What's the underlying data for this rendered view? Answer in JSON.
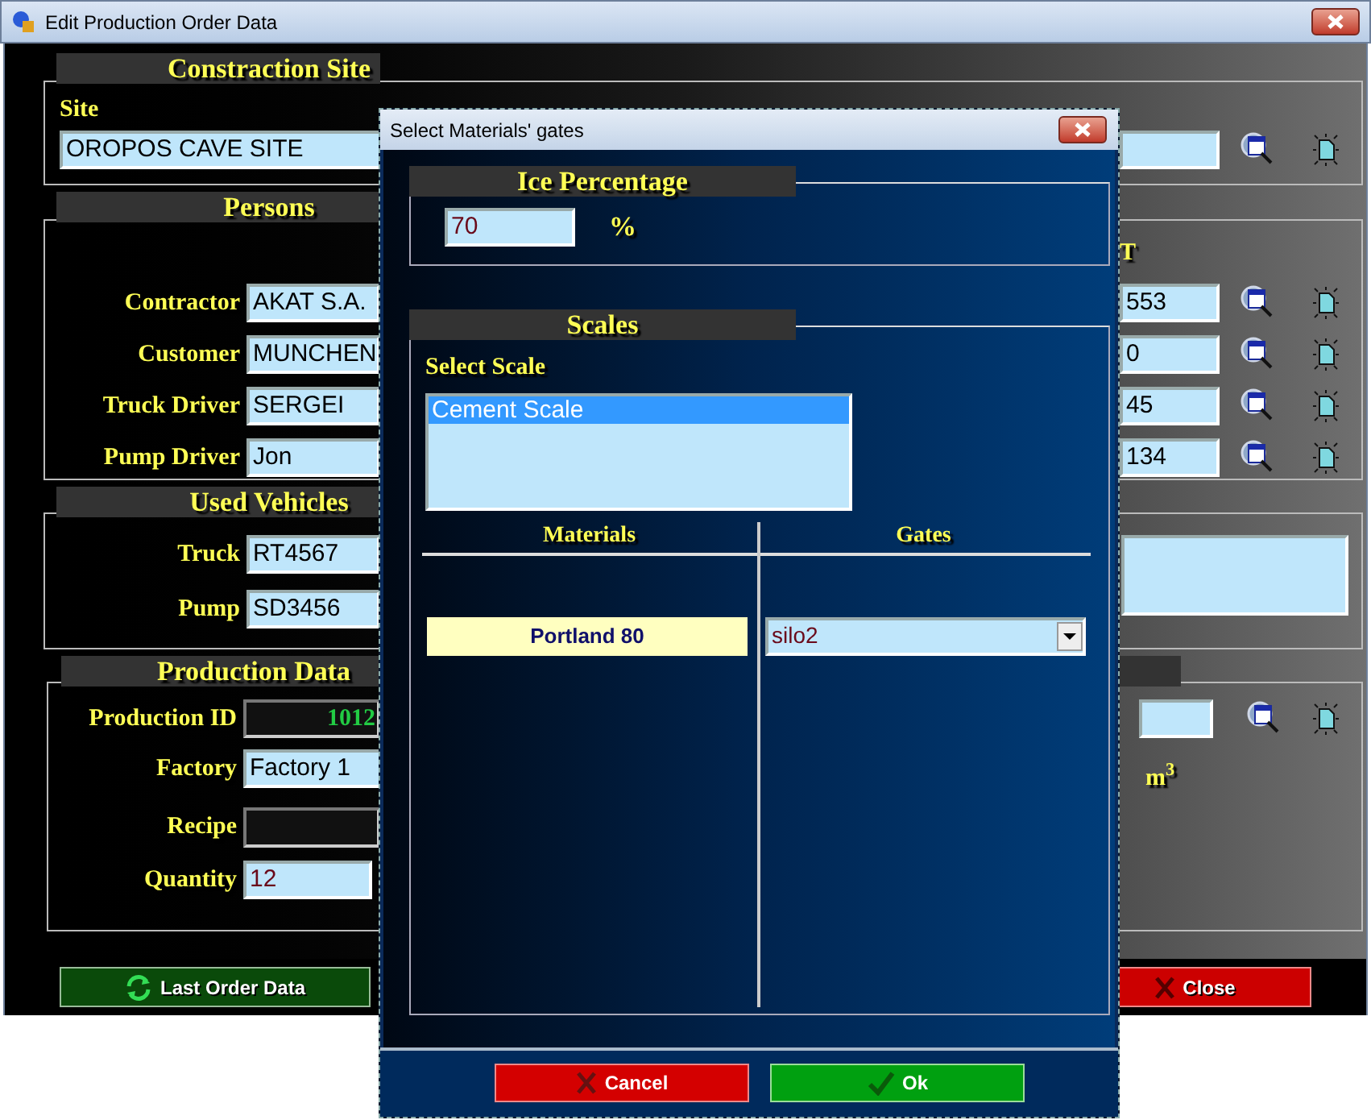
{
  "window": {
    "title": "Edit Production Order Data"
  },
  "construction_site": {
    "title": "Constraction Site",
    "site_label": "Site",
    "site_value": "OROPOS CAVE SITE"
  },
  "persons": {
    "title": "Persons",
    "column_label": "T",
    "rows": [
      {
        "label": "Contractor",
        "value": "AKAT S.A.",
        "value_2": "553"
      },
      {
        "label": "Customer",
        "value": "MUNCHEN",
        "value_2": "0"
      },
      {
        "label": "Truck Driver",
        "value": "SERGEI",
        "value_2": "45"
      },
      {
        "label": "Pump Driver",
        "value": "Jon",
        "value_2": "134"
      }
    ]
  },
  "used_vehicles": {
    "title": "Used Vehicles",
    "rows": [
      {
        "label": "Truck",
        "value": "RT4567"
      },
      {
        "label": "Pump",
        "value": "SD3456"
      }
    ]
  },
  "production_data": {
    "title": "Production Data",
    "unit": "m$^{3}$",
    "rows": [
      {
        "kind": "id",
        "label": "Production ID",
        "value": "1012"
      },
      {
        "kind": "text",
        "label": "Factory",
        "value": "Factory 1"
      },
      {
        "kind": "blank",
        "label": "Recipe"
      },
      {
        "kind": "number",
        "label": "Quantity",
        "value": "12"
      }
    ]
  },
  "buttons": [
    {
      "kind": "refresh",
      "label": "Last Order Data"
    },
    {
      "kind": "close",
      "label": "Close"
    }
  ],
  "dialog": {
    "title": "Select Materials' gates",
    "ice_percentage": {
      "title": "Ice Percentage",
      "value": "70",
      "unit": "%"
    },
    "scales": {
      "title": "Scales",
      "list_label": "Select Scale",
      "items": [
        {
          "label": "Cement Scale",
          "selected": true
        }
      ],
      "columns": [
        "Materials",
        "Gates"
      ],
      "rows": [
        {
          "material": "Portland 80",
          "gate": "silo2"
        }
      ]
    },
    "buttons": [
      {
        "kind": "cancel",
        "label": "Cancel"
      },
      {
        "kind": "ok",
        "label": "Ok"
      }
    ]
  }
}
